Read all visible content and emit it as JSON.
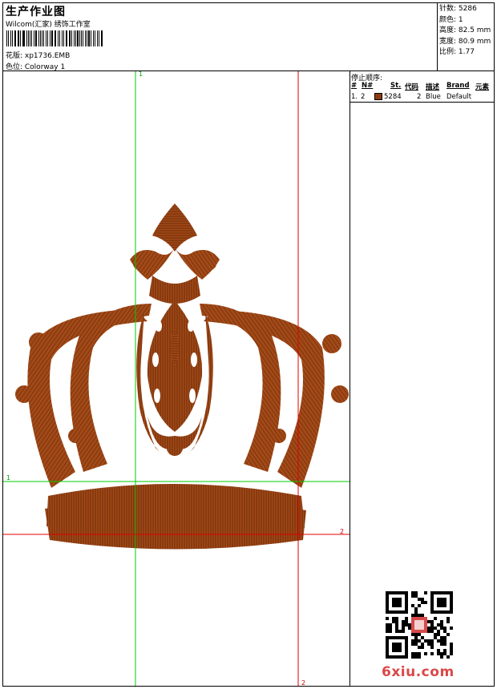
{
  "header": {
    "title": "生产作业图",
    "studio": "Wilcom(汇家) 绣饰工作室",
    "design_label": "花版: xp1736.EMB",
    "colorway_label": "色位: Colorway 1"
  },
  "stats": {
    "stitches": "针数: 5286",
    "colors": "颜色: 1",
    "height": "高度: 82.5 mm",
    "width": "宽度: 80.9 mm",
    "ratio": "比例: 1.77"
  },
  "stop_sequence": {
    "title": "停止顺序:",
    "headers": [
      "#",
      "N#",
      "St.",
      "代码",
      "描述",
      "Brand",
      "元素"
    ],
    "rows": [
      {
        "index": "1.",
        "needle": "2",
        "stitches": "5284",
        "code": "2",
        "description": "Blue",
        "brand": "Default",
        "color": "#8B3A0F"
      }
    ]
  },
  "guides": {
    "green_top": "1",
    "green_left": "1",
    "red_right": "2",
    "red_bottom": "2"
  },
  "embroidery": {
    "thread_color": "#8B3A0F",
    "subject": "crown"
  },
  "watermark": {
    "brand": "6xiu.com",
    "seal": "绣绣"
  }
}
